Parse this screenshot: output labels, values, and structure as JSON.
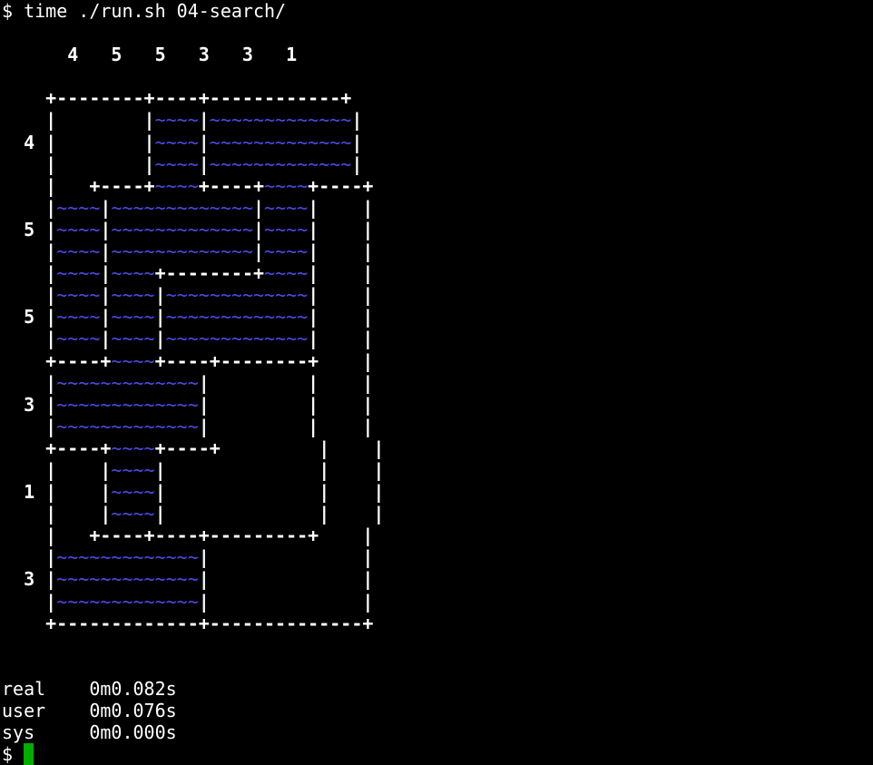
{
  "window": {
    "title": "time ./run.sh 04-search/"
  },
  "colors": {
    "background": "#000000",
    "foreground": "#ffffff",
    "water": "#4b4bea",
    "cursor": "#00ad00"
  },
  "terminal": {
    "lines": [
      [
        [
          "n",
          "$ time ./run.sh 04-search/"
        ]
      ],
      [],
      [
        [
          "b",
          "      4   5   5   3   3   1"
        ]
      ],
      [],
      [
        [
          "b",
          "    +--------+----+------------+"
        ]
      ],
      [
        [
          "b",
          "    |        |"
        ],
        [
          "w",
          "~~~~"
        ],
        [
          "b",
          "|"
        ],
        [
          "w",
          "~~~~~~~~~~~~~"
        ],
        [
          "b",
          "|"
        ]
      ],
      [
        [
          "b",
          "  4 |        |"
        ],
        [
          "w",
          "~~~~"
        ],
        [
          "b",
          "|"
        ],
        [
          "w",
          "~~~~~~~~~~~~~"
        ],
        [
          "b",
          "|"
        ]
      ],
      [
        [
          "b",
          "    |        |"
        ],
        [
          "w",
          "~~~~"
        ],
        [
          "b",
          "|"
        ],
        [
          "w",
          "~~~~~~~~~~~~~"
        ],
        [
          "b",
          "|"
        ]
      ],
      [
        [
          "b",
          "    |   +----+"
        ],
        [
          "w",
          "~~~~"
        ],
        [
          "b",
          "+----+"
        ],
        [
          "w",
          "~~~~"
        ],
        [
          "b",
          "+----+"
        ]
      ],
      [
        [
          "b",
          "    |"
        ],
        [
          "w",
          "~~~~"
        ],
        [
          "b",
          "|"
        ],
        [
          "w",
          "~~~~~~~~~~~~~"
        ],
        [
          "b",
          "|"
        ],
        [
          "w",
          "~~~~"
        ],
        [
          "b",
          "|    |"
        ]
      ],
      [
        [
          "b",
          "  5 |"
        ],
        [
          "w",
          "~~~~"
        ],
        [
          "b",
          "|"
        ],
        [
          "w",
          "~~~~~~~~~~~~~"
        ],
        [
          "b",
          "|"
        ],
        [
          "w",
          "~~~~"
        ],
        [
          "b",
          "|    |"
        ]
      ],
      [
        [
          "b",
          "    |"
        ],
        [
          "w",
          "~~~~"
        ],
        [
          "b",
          "|"
        ],
        [
          "w",
          "~~~~~~~~~~~~~"
        ],
        [
          "b",
          "|"
        ],
        [
          "w",
          "~~~~"
        ],
        [
          "b",
          "|    |"
        ]
      ],
      [
        [
          "b",
          "    |"
        ],
        [
          "w",
          "~~~~"
        ],
        [
          "b",
          "|"
        ],
        [
          "w",
          "~~~~"
        ],
        [
          "b",
          "+--------+"
        ],
        [
          "w",
          "~~~~"
        ],
        [
          "b",
          "|    |"
        ]
      ],
      [
        [
          "b",
          "    |"
        ],
        [
          "w",
          "~~~~"
        ],
        [
          "b",
          "|"
        ],
        [
          "w",
          "~~~~"
        ],
        [
          "b",
          "|"
        ],
        [
          "w",
          "~~~~~~~~~~~~~"
        ],
        [
          "b",
          "|    |"
        ]
      ],
      [
        [
          "b",
          "  5 |"
        ],
        [
          "w",
          "~~~~"
        ],
        [
          "b",
          "|"
        ],
        [
          "w",
          "~~~~"
        ],
        [
          "b",
          "|"
        ],
        [
          "w",
          "~~~~~~~~~~~~~"
        ],
        [
          "b",
          "|    |"
        ]
      ],
      [
        [
          "b",
          "    |"
        ],
        [
          "w",
          "~~~~"
        ],
        [
          "b",
          "|"
        ],
        [
          "w",
          "~~~~"
        ],
        [
          "b",
          "|"
        ],
        [
          "w",
          "~~~~~~~~~~~~~"
        ],
        [
          "b",
          "|    |"
        ]
      ],
      [
        [
          "b",
          "    +----+"
        ],
        [
          "w",
          "~~~~"
        ],
        [
          "b",
          "+----+--------+    |"
        ]
      ],
      [
        [
          "b",
          "    |"
        ],
        [
          "w",
          "~~~~~~~~~~~~~"
        ],
        [
          "b",
          "|         |    |"
        ]
      ],
      [
        [
          "b",
          "  3 |"
        ],
        [
          "w",
          "~~~~~~~~~~~~~"
        ],
        [
          "b",
          "|         |    |"
        ]
      ],
      [
        [
          "b",
          "    |"
        ],
        [
          "w",
          "~~~~~~~~~~~~~"
        ],
        [
          "b",
          "|         |    |"
        ]
      ],
      [
        [
          "b",
          "    +----+"
        ],
        [
          "w",
          "~~~~"
        ],
        [
          "b",
          "+----+         |    |"
        ]
      ],
      [
        [
          "b",
          "    |    |"
        ],
        [
          "w",
          "~~~~"
        ],
        [
          "b",
          "|              |    |"
        ]
      ],
      [
        [
          "b",
          "  1 |    |"
        ],
        [
          "w",
          "~~~~"
        ],
        [
          "b",
          "|              |    |"
        ]
      ],
      [
        [
          "b",
          "    |    |"
        ],
        [
          "w",
          "~~~~"
        ],
        [
          "b",
          "|              |    |"
        ]
      ],
      [
        [
          "b",
          "    |   +----+----+---------+    |"
        ]
      ],
      [
        [
          "b",
          "    |"
        ],
        [
          "w",
          "~~~~~~~~~~~~~"
        ],
        [
          "b",
          "|              |"
        ]
      ],
      [
        [
          "b",
          "  3 |"
        ],
        [
          "w",
          "~~~~~~~~~~~~~"
        ],
        [
          "b",
          "|              |"
        ]
      ],
      [
        [
          "b",
          "    |"
        ],
        [
          "w",
          "~~~~~~~~~~~~~"
        ],
        [
          "b",
          "|              |"
        ]
      ],
      [
        [
          "b",
          "    +-------------+--------------+"
        ]
      ],
      [],
      [],
      [
        [
          "n",
          "real    0m0.082s"
        ]
      ],
      [
        [
          "n",
          "user    0m0.076s"
        ]
      ],
      [
        [
          "n",
          "sys     0m0.000s"
        ]
      ],
      [
        [
          "n",
          "$ "
        ],
        [
          "cursor",
          ""
        ]
      ]
    ]
  }
}
